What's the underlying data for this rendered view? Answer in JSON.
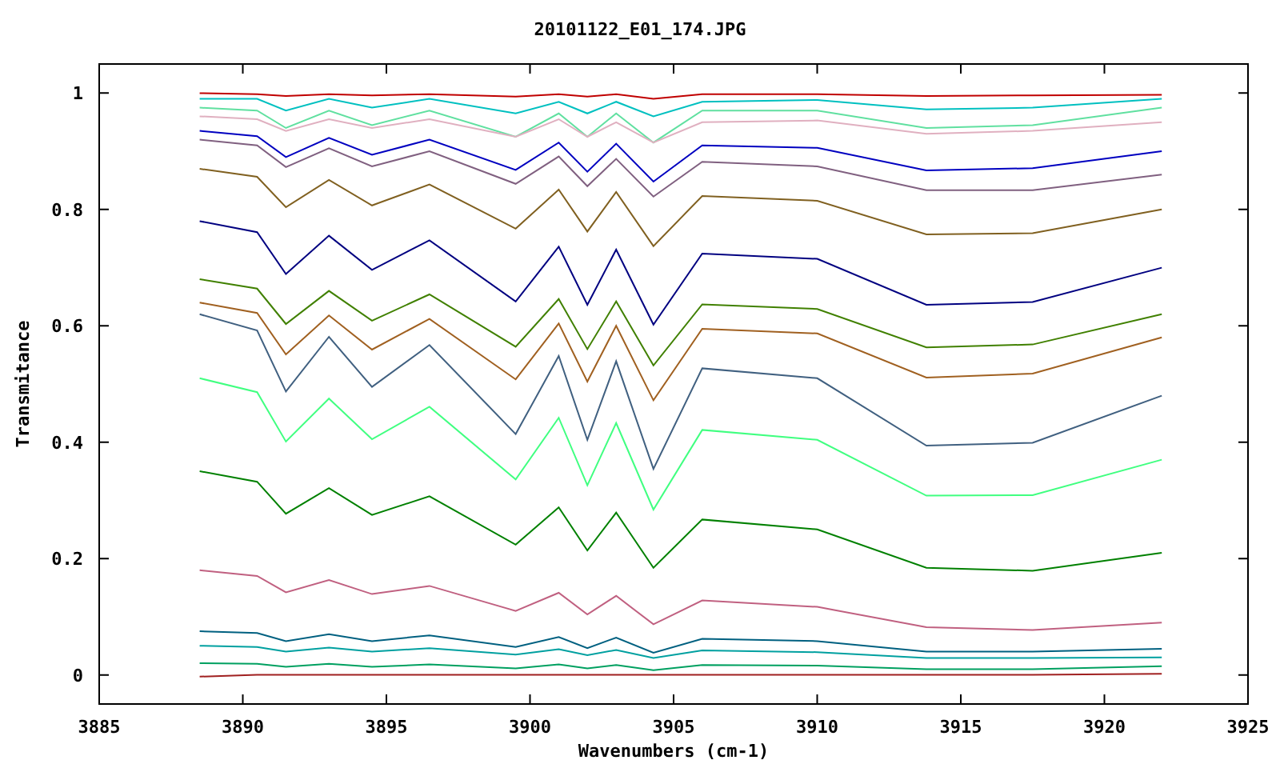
{
  "chart_data": {
    "type": "line",
    "title": "20101122_E01_174.JPG",
    "xlabel": "Wavenumbers (cm-1)",
    "ylabel": "Transmitance",
    "xlim": [
      3885,
      3925
    ],
    "ylim": [
      -0.05,
      1.05
    ],
    "xticks": [
      3885,
      3890,
      3895,
      3900,
      3905,
      3910,
      3915,
      3920,
      3925
    ],
    "yticks": [
      0,
      0.2,
      0.4,
      0.6,
      0.8,
      1
    ],
    "x": [
      3888.5,
      3890.5,
      3891.5,
      3893,
      3894.5,
      3896.5,
      3899.5,
      3901,
      3902,
      3903,
      3904.3,
      3906,
      3910,
      3913.8,
      3917.5,
      3922
    ],
    "series": [
      {
        "color": "#c00000",
        "values": [
          1.0,
          0.998,
          0.995,
          0.998,
          0.996,
          0.998,
          0.994,
          0.998,
          0.994,
          0.998,
          0.99,
          0.998,
          0.998,
          0.995,
          0.996,
          0.997
        ]
      },
      {
        "color": "#00c0c0",
        "values": [
          0.99,
          0.99,
          0.97,
          0.99,
          0.975,
          0.99,
          0.965,
          0.985,
          0.965,
          0.985,
          0.96,
          0.985,
          0.988,
          0.972,
          0.975,
          0.99
        ]
      },
      {
        "color": "#60e0a0",
        "values": [
          0.975,
          0.97,
          0.94,
          0.97,
          0.945,
          0.97,
          0.925,
          0.965,
          0.925,
          0.965,
          0.915,
          0.97,
          0.97,
          0.94,
          0.945,
          0.975
        ]
      },
      {
        "color": "#e0b0c0",
        "values": [
          0.96,
          0.955,
          0.935,
          0.955,
          0.94,
          0.955,
          0.925,
          0.955,
          0.925,
          0.95,
          0.915,
          0.95,
          0.953,
          0.93,
          0.935,
          0.95
        ]
      },
      {
        "color": "#0000c0",
        "values": [
          0.935,
          0.926,
          0.89,
          0.923,
          0.894,
          0.92,
          0.868,
          0.915,
          0.865,
          0.913,
          0.848,
          0.91,
          0.906,
          0.867,
          0.871,
          0.9
        ]
      },
      {
        "color": "#806080",
        "values": [
          0.92,
          0.91,
          0.873,
          0.905,
          0.874,
          0.9,
          0.844,
          0.891,
          0.84,
          0.887,
          0.822,
          0.882,
          0.874,
          0.833,
          0.833,
          0.86
        ]
      },
      {
        "color": "#806020",
        "values": [
          0.87,
          0.856,
          0.804,
          0.851,
          0.807,
          0.843,
          0.767,
          0.834,
          0.762,
          0.83,
          0.737,
          0.823,
          0.815,
          0.757,
          0.759,
          0.8
        ]
      },
      {
        "color": "#000080",
        "values": [
          0.78,
          0.761,
          0.689,
          0.755,
          0.696,
          0.747,
          0.642,
          0.736,
          0.636,
          0.731,
          0.602,
          0.724,
          0.715,
          0.636,
          0.641,
          0.7
        ]
      },
      {
        "color": "#408000",
        "values": [
          0.68,
          0.664,
          0.603,
          0.66,
          0.609,
          0.654,
          0.564,
          0.646,
          0.56,
          0.642,
          0.532,
          0.637,
          0.629,
          0.563,
          0.568,
          0.62
        ]
      },
      {
        "color": "#a06020",
        "values": [
          0.64,
          0.622,
          0.551,
          0.618,
          0.559,
          0.612,
          0.508,
          0.604,
          0.504,
          0.6,
          0.472,
          0.595,
          0.587,
          0.511,
          0.518,
          0.58
        ]
      },
      {
        "color": "#406080",
        "values": [
          0.62,
          0.592,
          0.487,
          0.581,
          0.495,
          0.567,
          0.414,
          0.548,
          0.404,
          0.539,
          0.354,
          0.527,
          0.51,
          0.394,
          0.399,
          0.48
        ]
      },
      {
        "color": "#40ff80",
        "values": [
          0.51,
          0.486,
          0.401,
          0.475,
          0.405,
          0.461,
          0.336,
          0.442,
          0.326,
          0.433,
          0.284,
          0.421,
          0.404,
          0.308,
          0.309,
          0.37
        ]
      },
      {
        "color": "#008000",
        "values": [
          0.35,
          0.332,
          0.277,
          0.321,
          0.275,
          0.307,
          0.224,
          0.288,
          0.214,
          0.279,
          0.184,
          0.267,
          0.25,
          0.184,
          0.179,
          0.21
        ]
      },
      {
        "color": "#c06080",
        "values": [
          0.18,
          0.17,
          0.142,
          0.163,
          0.139,
          0.153,
          0.11,
          0.141,
          0.104,
          0.136,
          0.087,
          0.128,
          0.117,
          0.082,
          0.077,
          0.09
        ]
      },
      {
        "color": "#006080",
        "values": [
          0.075,
          0.072,
          0.058,
          0.07,
          0.058,
          0.068,
          0.048,
          0.065,
          0.046,
          0.064,
          0.038,
          0.062,
          0.058,
          0.04,
          0.04,
          0.045
        ]
      },
      {
        "color": "#00a0a0",
        "values": [
          0.05,
          0.048,
          0.04,
          0.047,
          0.04,
          0.046,
          0.035,
          0.044,
          0.034,
          0.043,
          0.029,
          0.042,
          0.039,
          0.029,
          0.029,
          0.03
        ]
      },
      {
        "color": "#00a060",
        "values": [
          0.02,
          0.019,
          0.014,
          0.019,
          0.014,
          0.018,
          0.011,
          0.018,
          0.011,
          0.017,
          0.008,
          0.017,
          0.016,
          0.01,
          0.01,
          0.015
        ]
      },
      {
        "color": "#a02020",
        "values": [
          -0.003,
          0,
          0,
          0,
          0,
          0,
          0,
          0,
          0,
          0,
          0,
          0,
          0,
          0,
          0,
          0.002
        ]
      }
    ]
  }
}
